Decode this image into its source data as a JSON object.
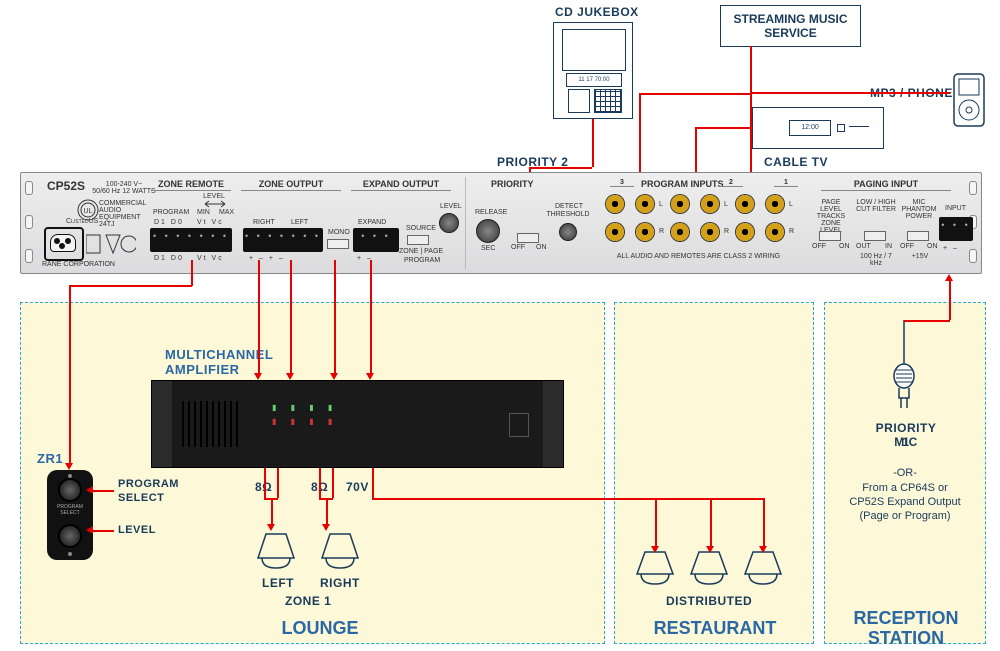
{
  "external_devices": {
    "cd_jukebox": "CD JUKEBOX",
    "streaming": "STREAMING MUSIC SERVICE",
    "mp3_phone": "MP3 / PHONE",
    "cable_tv": "CABLE TV",
    "cd_display": "11 17 70:00",
    "tv_display": "12:00"
  },
  "priorities": {
    "p2": "PRIORITY 2",
    "p1a": "PRIORITY 1",
    "p1b": "MIC"
  },
  "rack": {
    "model": "CP52S",
    "power": "100-240 V~\n50/60 Hz 12 WATTS",
    "cert": "COMMERCIAL AUDIO EQUIPMENT 24TJ",
    "company": "RANE CORPORATION",
    "zone_remote": "ZONE REMOTE",
    "zone_output": "ZONE OUTPUT",
    "expand_output": "EXPAND OUTPUT",
    "priority": "PRIORITY",
    "program_inputs": "PROGRAM INPUTS",
    "paging_input": "PAGING INPUT",
    "program": "PROGRAM",
    "level": "LEVEL",
    "min": "MIN",
    "max": "MAX",
    "right": "RIGHT",
    "left": "LEFT",
    "mono": "MONO",
    "expand": "EXPAND",
    "source": "SOURCE",
    "zone_page": "ZONE | PAGE",
    "program2": "PROGRAM",
    "level2": "LEVEL",
    "release": "RELEASE",
    "sec": "SEC",
    "detect": "DETECT",
    "threshold": "THRESHOLD",
    "off": "OFF",
    "on": "ON",
    "num3": "3",
    "num2": "2",
    "num1": "1",
    "L": "L",
    "R": "R",
    "class2": "ALL AUDIO AND REMOTES ARE CLASS 2 WIRING",
    "page_level": "PAGE LEVEL",
    "tracks": "TRACKS",
    "zone_level": "ZONE LEVEL",
    "filter": "LOW / HIGH CUT FILTER",
    "filter_vals": "100 Hz / 7 kHz",
    "phantom": "MIC PHANTOM POWER",
    "phantom_v": "+15V",
    "out": "OUT",
    "in": "IN",
    "input": "INPUT",
    "d1d0": "D1 D0",
    "vtvc": "Vt Vc",
    "sig": "+  –   +  –",
    "sig2": "+  –"
  },
  "zones": {
    "lounge": "LOUNGE",
    "restaurant": "RESTAURANT",
    "reception": "RECEPTION STATION"
  },
  "lounge": {
    "amp_title": "MULTICHANNEL",
    "amp_title2": "AMPLIFIER",
    "imp1": "8Ω",
    "imp2": "8Ω",
    "imp3": "70V",
    "left": "LEFT",
    "right": "RIGHT",
    "zone1": "ZONE 1"
  },
  "zr1": {
    "name": "ZR1",
    "program": "PROGRAM",
    "select": "SELECT",
    "level": "LEVEL",
    "panel": "PROGRAM SELECT"
  },
  "restaurant": {
    "distributed": "DISTRIBUTED"
  },
  "reception": {
    "or": "-OR-",
    "note1": "From a CP64S or",
    "note2": "CP52S Expand Output",
    "note3": "(Page or Program)"
  }
}
